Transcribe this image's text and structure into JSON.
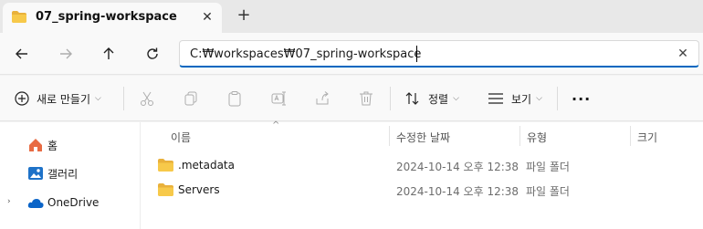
{
  "tab": {
    "title": "07_spring-workspace",
    "close_glyph": "✕",
    "new_tab_glyph": "+"
  },
  "address": {
    "path": "C:₩workspaces₩07_spring-workspace",
    "clear_glyph": "✕"
  },
  "commands": {
    "new_label": "새로 만들기",
    "sort_label": "정렬",
    "view_label": "보기",
    "more_glyph": "···",
    "chevron": "⌵"
  },
  "nav_pane": {
    "items": [
      {
        "label": "홈",
        "icon": "home-icon"
      },
      {
        "label": "갤러리",
        "icon": "gallery-icon"
      },
      {
        "label": "OneDrive",
        "icon": "onedrive-icon",
        "expand": "›"
      }
    ]
  },
  "columns": {
    "name": "이름",
    "modified": "수정한 날짜",
    "type": "유형",
    "size": "크기",
    "sort_glyph": "^"
  },
  "files": [
    {
      "name": ".metadata",
      "modified": "2024-10-14 오후 12:38",
      "type": "파일 폴더"
    },
    {
      "name": "Servers",
      "modified": "2024-10-14 오후 12:38",
      "type": "파일 폴더"
    }
  ],
  "colors": {
    "accent": "#0067c0",
    "folder": "#f4c430",
    "onedrive": "#0a64c8"
  }
}
